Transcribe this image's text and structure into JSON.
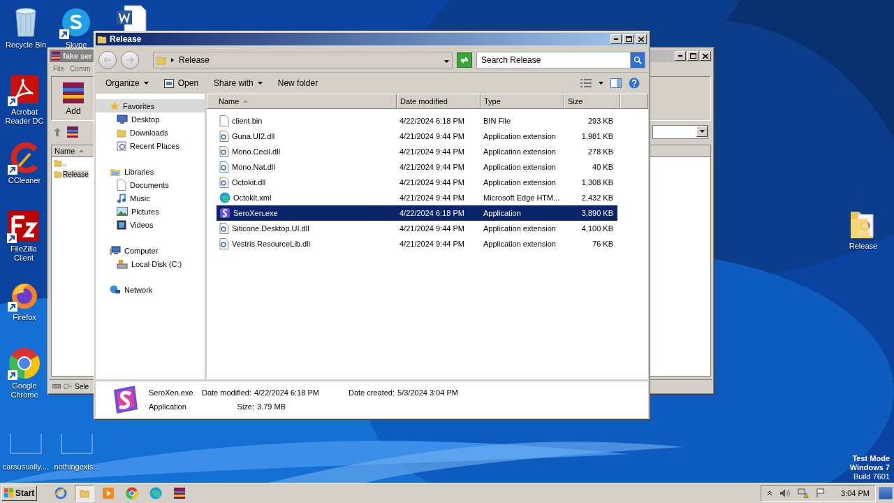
{
  "desktop_icons": [
    {
      "label": "Recycle Bin",
      "shortcut": false
    },
    {
      "label": "Skype",
      "shortcut": true
    },
    {
      "label": "Acrobat Reader DC",
      "shortcut": true
    },
    {
      "label": "CCleaner",
      "shortcut": true
    },
    {
      "label": "FileZilla Client",
      "shortcut": true
    },
    {
      "label": "Firefox",
      "shortcut": true
    },
    {
      "label": "Google Chrome",
      "shortcut": true
    },
    {
      "label": "carsusually....",
      "shortcut": false
    },
    {
      "label": "nothingexis...",
      "shortcut": false
    },
    {
      "label": "Release",
      "shortcut": false
    }
  ],
  "background_window": {
    "title": "fake ser",
    "menu": [
      "File",
      "Comm"
    ],
    "toolbar": [
      "Add"
    ],
    "list_header": "Name",
    "rows": [
      {
        "name": "..",
        "selected": false
      },
      {
        "name": "Release",
        "selected": true
      }
    ],
    "status": "Sele"
  },
  "explorer": {
    "title": "Release",
    "address": "Release",
    "search": {
      "placeholder": "Search Release"
    },
    "commands": [
      {
        "label": "Organize",
        "dropdown": true
      },
      {
        "label": "Open",
        "dropdown": false
      },
      {
        "label": "Share with",
        "dropdown": true
      },
      {
        "label": "New folder",
        "dropdown": false
      }
    ],
    "navigation": [
      {
        "label": "Favorites",
        "selected": true,
        "children": [
          {
            "label": "Desktop",
            "selected": false
          },
          {
            "label": "Downloads",
            "selected": false
          },
          {
            "label": "Recent Places",
            "selected": false
          }
        ]
      },
      {
        "label": "Libraries",
        "selected": false,
        "children": [
          {
            "label": "Documents",
            "selected": false
          },
          {
            "label": "Music",
            "selected": false
          },
          {
            "label": "Pictures",
            "selected": false
          },
          {
            "label": "Videos",
            "selected": false
          }
        ]
      },
      {
        "label": "Computer",
        "selected": false,
        "children": [
          {
            "label": "Local Disk (C:)",
            "selected": false
          }
        ]
      },
      {
        "label": "Network",
        "selected": false
      }
    ],
    "columns": [
      "Name",
      "Date modified",
      "Type",
      "Size"
    ],
    "files": [
      {
        "name": "client.bin",
        "date": "4/22/2024 6:18 PM",
        "type": "BIN File",
        "size": "293 KB",
        "kind": "bin",
        "selected": false
      },
      {
        "name": "Guna.UI2.dll",
        "date": "4/21/2024 9:44 PM",
        "type": "Application extension",
        "size": "1,981 KB",
        "kind": "dll",
        "selected": false
      },
      {
        "name": "Mono.Cecil.dll",
        "date": "4/21/2024 9:44 PM",
        "type": "Application extension",
        "size": "278 KB",
        "kind": "dll",
        "selected": false
      },
      {
        "name": "Mono.Nat.dll",
        "date": "4/21/2024 9:44 PM",
        "type": "Application extension",
        "size": "40 KB",
        "kind": "dll",
        "selected": false
      },
      {
        "name": "Octokit.dll",
        "date": "4/21/2024 9:44 PM",
        "type": "Application extension",
        "size": "1,308 KB",
        "kind": "dll",
        "selected": false
      },
      {
        "name": "Octokit.xml",
        "date": "4/21/2024 9:44 PM",
        "type": "Microsoft Edge HTM...",
        "size": "2,432 KB",
        "kind": "web",
        "selected": false
      },
      {
        "name": "SeroXen.exe",
        "date": "4/22/2024 6:18 PM",
        "type": "Application",
        "size": "3,890 KB",
        "kind": "app",
        "selected": true
      },
      {
        "name": "Siticone.Desktop.UI.dll",
        "date": "4/21/2024 9:44 PM",
        "type": "Application extension",
        "size": "4,100 KB",
        "kind": "dll",
        "selected": false
      },
      {
        "name": "Vestris.ResourceLib.dll",
        "date": "4/21/2024 9:44 PM",
        "type": "Application extension",
        "size": "76 KB",
        "kind": "dll",
        "selected": false
      }
    ],
    "details": {
      "name": "SeroXen.exe",
      "type": "Application",
      "modified_label": "Date modified:",
      "modified": "4/22/2024 6:18 PM",
      "size_label": "Size:",
      "size": "3.79 MB",
      "created_label": "Date created:",
      "created": "5/3/2024 3:04 PM"
    }
  },
  "taskbar": {
    "start": "Start",
    "apps": [
      {
        "active": false
      },
      {
        "active": true
      },
      {
        "active": false
      },
      {
        "active": false
      },
      {
        "active": false
      },
      {
        "active": false
      }
    ],
    "clock": "3:04 PM"
  },
  "system_notice": [
    "Test Mode",
    "Windows 7",
    "Build 7601"
  ]
}
